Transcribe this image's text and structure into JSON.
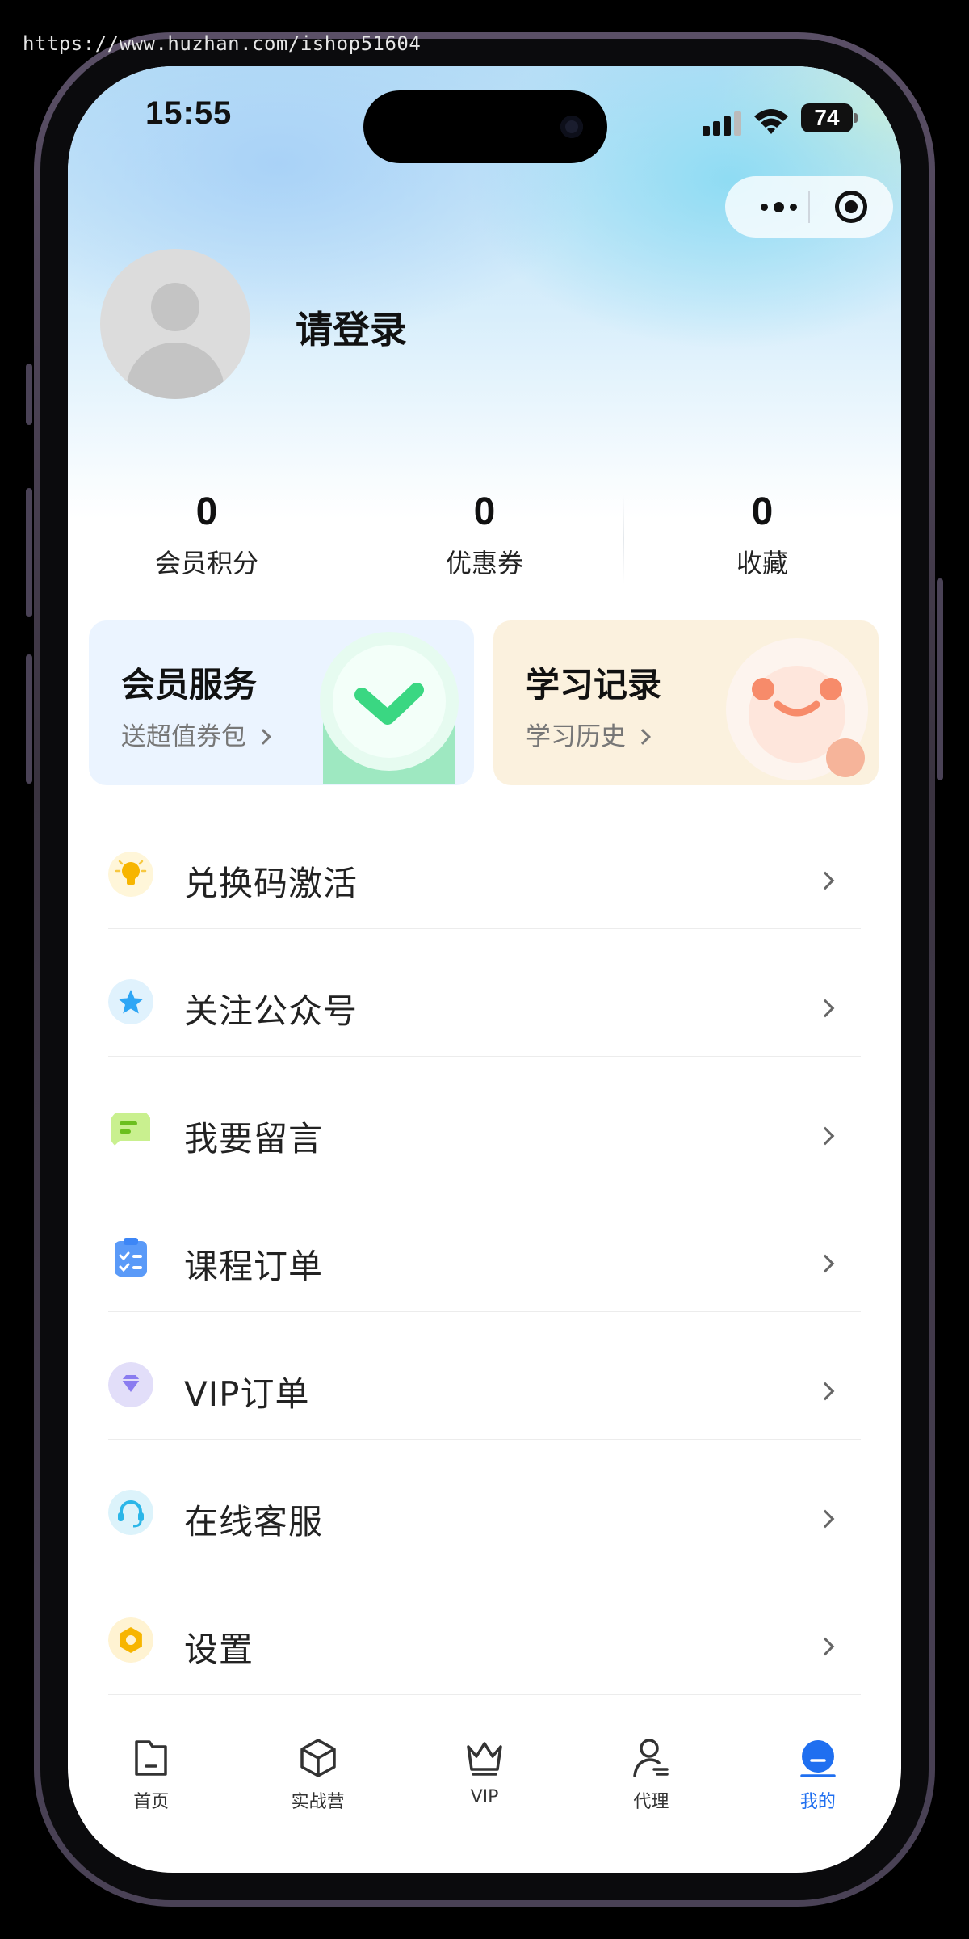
{
  "watermark": "https://www.huzhan.com/ishop51604",
  "status_bar": {
    "time": "15:55",
    "battery": "74"
  },
  "profile": {
    "login_text": "请登录"
  },
  "stats": [
    {
      "value": "0",
      "label": "会员积分"
    },
    {
      "value": "0",
      "label": "优惠券"
    },
    {
      "value": "0",
      "label": "收藏"
    }
  ],
  "cards": {
    "member": {
      "title": "会员服务",
      "subtitle": "送超值券包"
    },
    "study": {
      "title": "学习记录",
      "subtitle": "学习历史"
    }
  },
  "menu": [
    {
      "label": "兑换码激活",
      "icon": "lightbulb-icon",
      "color": "#f7b500"
    },
    {
      "label": "关注公众号",
      "icon": "star-icon",
      "color": "#2ea6f5"
    },
    {
      "label": "我要留言",
      "icon": "message-icon",
      "color": "#7fcf2e"
    },
    {
      "label": "课程订单",
      "icon": "clipboard-icon",
      "color": "#3d86f6"
    },
    {
      "label": "VIP订单",
      "icon": "diamond-icon",
      "color": "#8a7cf0"
    },
    {
      "label": "在线客服",
      "icon": "headset-icon",
      "color": "#2bb6e8"
    },
    {
      "label": "设置",
      "icon": "gear-icon",
      "color": "#f7b500"
    }
  ],
  "tabbar": [
    {
      "label": "首页",
      "icon": "home-icon",
      "active": false
    },
    {
      "label": "实战营",
      "icon": "cube-icon",
      "active": false
    },
    {
      "label": "VIP",
      "icon": "crown-icon",
      "active": false
    },
    {
      "label": "代理",
      "icon": "agent-icon",
      "active": false
    },
    {
      "label": "我的",
      "icon": "profile-icon",
      "active": true
    }
  ],
  "colors": {
    "accent": "#1f6ff0",
    "member_card_bg": "#ebf4ff",
    "study_card_bg": "#fbf1de"
  }
}
